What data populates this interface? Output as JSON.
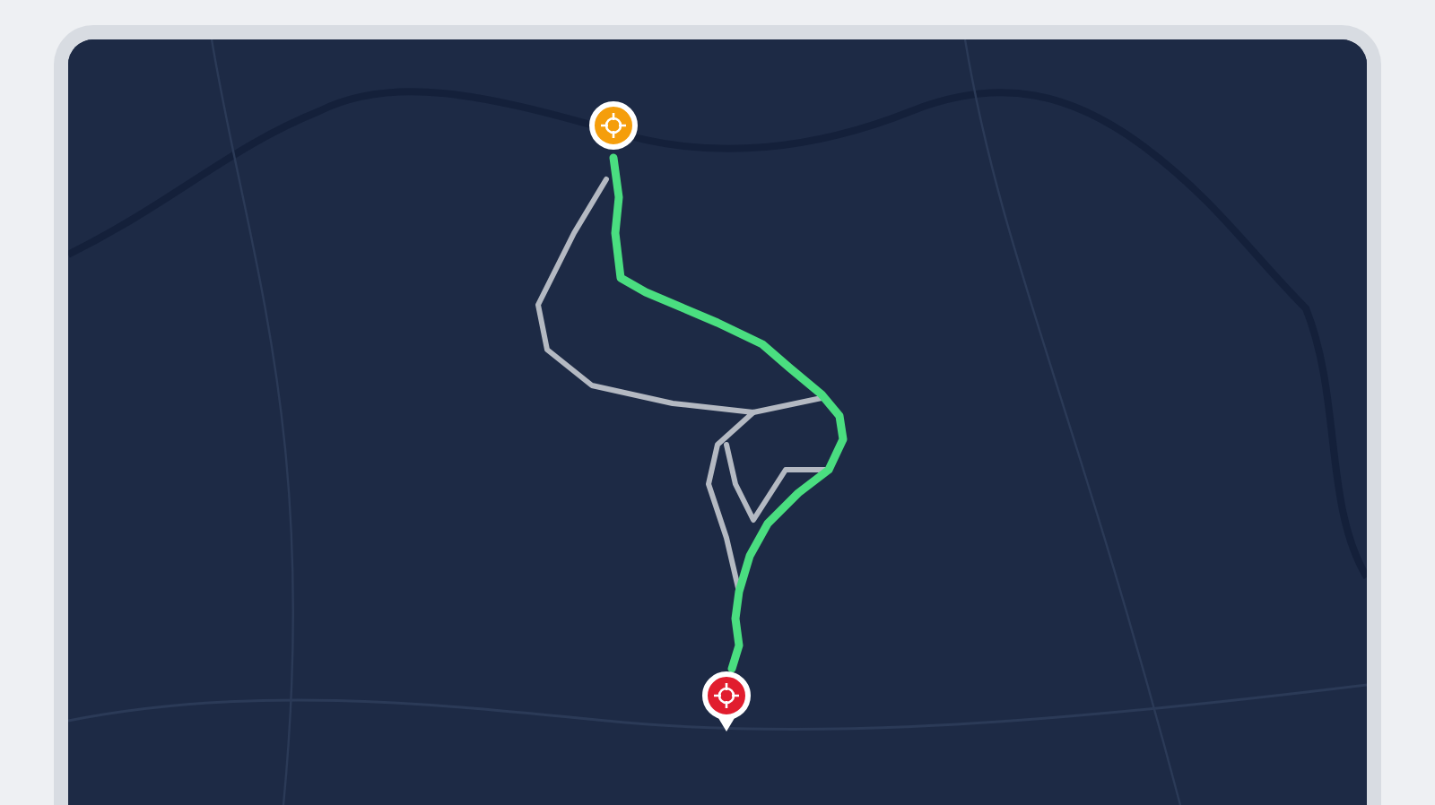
{
  "map": {
    "routes": [
      {
        "selected": true
      },
      {
        "selected": false
      },
      {
        "selected": false
      },
      {
        "selected": false
      }
    ],
    "markers": [
      {
        "kind": "start",
        "color": "#f59e0b"
      },
      {
        "kind": "end",
        "color": "#e11d2e"
      }
    ]
  }
}
